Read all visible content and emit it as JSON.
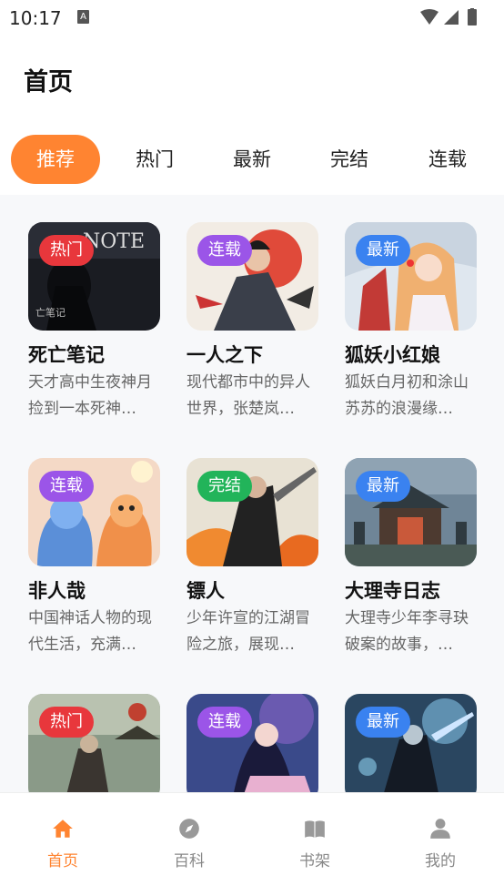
{
  "status_bar": {
    "time": "10:17",
    "notification_icon": "A"
  },
  "header": {
    "title": "首页"
  },
  "tabs": [
    {
      "label": "推荐",
      "active": true
    },
    {
      "label": "热门",
      "active": false
    },
    {
      "label": "最新",
      "active": false
    },
    {
      "label": "完结",
      "active": false
    },
    {
      "label": "连载",
      "active": false
    }
  ],
  "badge_colors": {
    "热门": "#e8373c",
    "连载": "#9b55e8",
    "最新": "#3a82f0",
    "完结": "#22b45a"
  },
  "accent_color": "#ff8431",
  "cards": [
    {
      "title": "死亡笔记",
      "badge": "热门",
      "desc": "天才高中生夜神月捡到一本死神…"
    },
    {
      "title": "一人之下",
      "badge": "连载",
      "desc": "现代都市中的异人世界，张楚岚…"
    },
    {
      "title": "狐妖小红娘",
      "badge": "最新",
      "desc": "狐妖白月初和涂山苏苏的浪漫缘…"
    },
    {
      "title": "非人哉",
      "badge": "连载",
      "desc": "中国神话人物的现代生活，充满…"
    },
    {
      "title": "镖人",
      "badge": "完结",
      "desc": "少年许宣的江湖冒险之旅，展现…"
    },
    {
      "title": "大理寺日志",
      "badge": "最新",
      "desc": "大理寺少年李寻玦破案的故事，…"
    },
    {
      "title": "",
      "badge": "热门",
      "desc": ""
    },
    {
      "title": "",
      "badge": "连载",
      "desc": ""
    },
    {
      "title": "",
      "badge": "最新",
      "desc": ""
    }
  ],
  "bottom_nav": [
    {
      "label": "首页",
      "icon": "home-icon",
      "active": true
    },
    {
      "label": "百科",
      "icon": "compass-icon",
      "active": false
    },
    {
      "label": "书架",
      "icon": "book-icon",
      "active": false
    },
    {
      "label": "我的",
      "icon": "user-icon",
      "active": false
    }
  ]
}
